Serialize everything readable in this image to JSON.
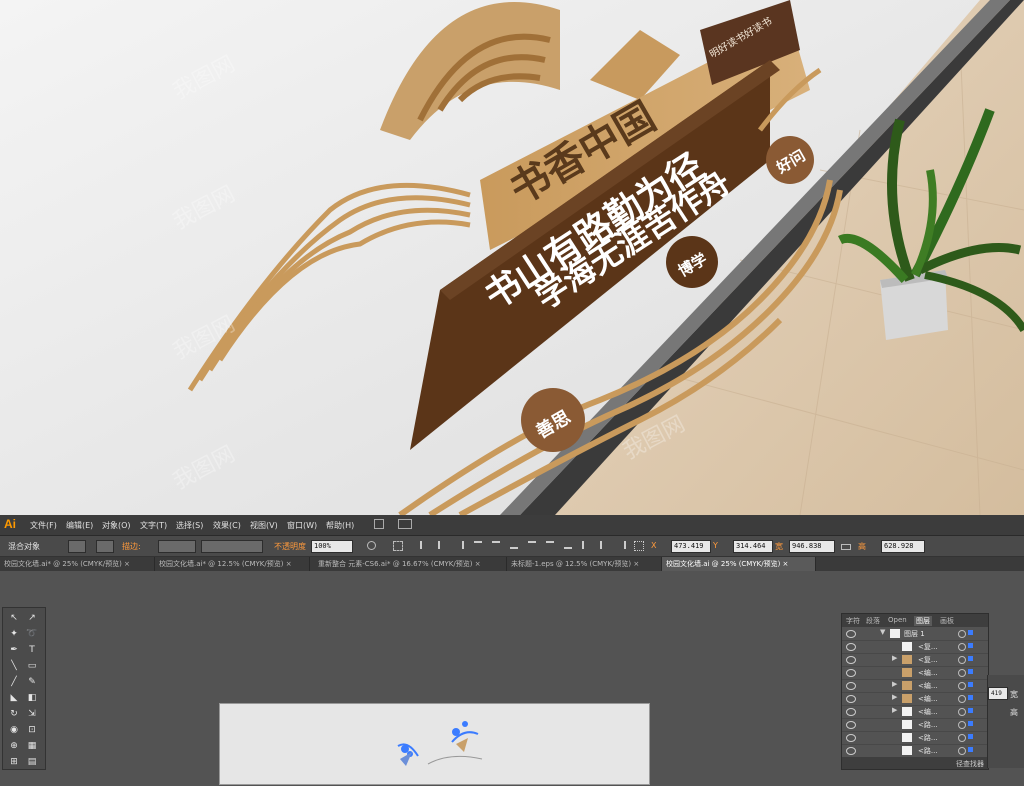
{
  "scene": {
    "banner_top": "书香中国",
    "board_line1": "书山有路勤为径",
    "board_line2": "学海无涯苦作舟",
    "side_tag": "明好读书好读书",
    "badge_1": "好问",
    "badge_2": "博学",
    "badge_3": "善思",
    "watermark": "我图网"
  },
  "app": {
    "logo": "Ai",
    "menu": [
      "文件(F)",
      "编辑(E)",
      "对象(O)",
      "文字(T)",
      "选择(S)",
      "效果(C)",
      "视图(V)",
      "窗口(W)",
      "帮助(H)"
    ],
    "control": {
      "label": "混合对象",
      "stroke_label": "描边:",
      "opacity_label": "不透明度",
      "opacity_value": "100%",
      "x_value": "473.419",
      "y_value": "314.464",
      "w_label": "宽",
      "w_value": "946.838",
      "h_label": "高",
      "h_value": "628.928"
    },
    "tabs": [
      "校园文化墙.ai* @ 25% (CMYK/预览)",
      "校园文化墙.ai* @ 12.5% (CMYK/预览)",
      "重新整合 元素-CS6.ai* @ 16.67% (CMYK/预览)",
      "未标题-1.eps @ 12.5% (CMYK/预览)",
      "校园文化墙.ai @ 25% (CMYK/预览)"
    ],
    "tab_close": "×",
    "layers_panel": {
      "tabs": [
        "字符",
        "段落",
        "Open",
        "图层",
        "画板"
      ],
      "rows": [
        "图层 1",
        "<复...",
        "<复...",
        "<编...",
        "<编...",
        "<编...",
        "<编...",
        "<路...",
        "<路...",
        "<路..."
      ],
      "footer": "径查找器"
    },
    "props": {
      "x_value": "419",
      "w_label": "宽",
      "h_label": "高"
    }
  }
}
